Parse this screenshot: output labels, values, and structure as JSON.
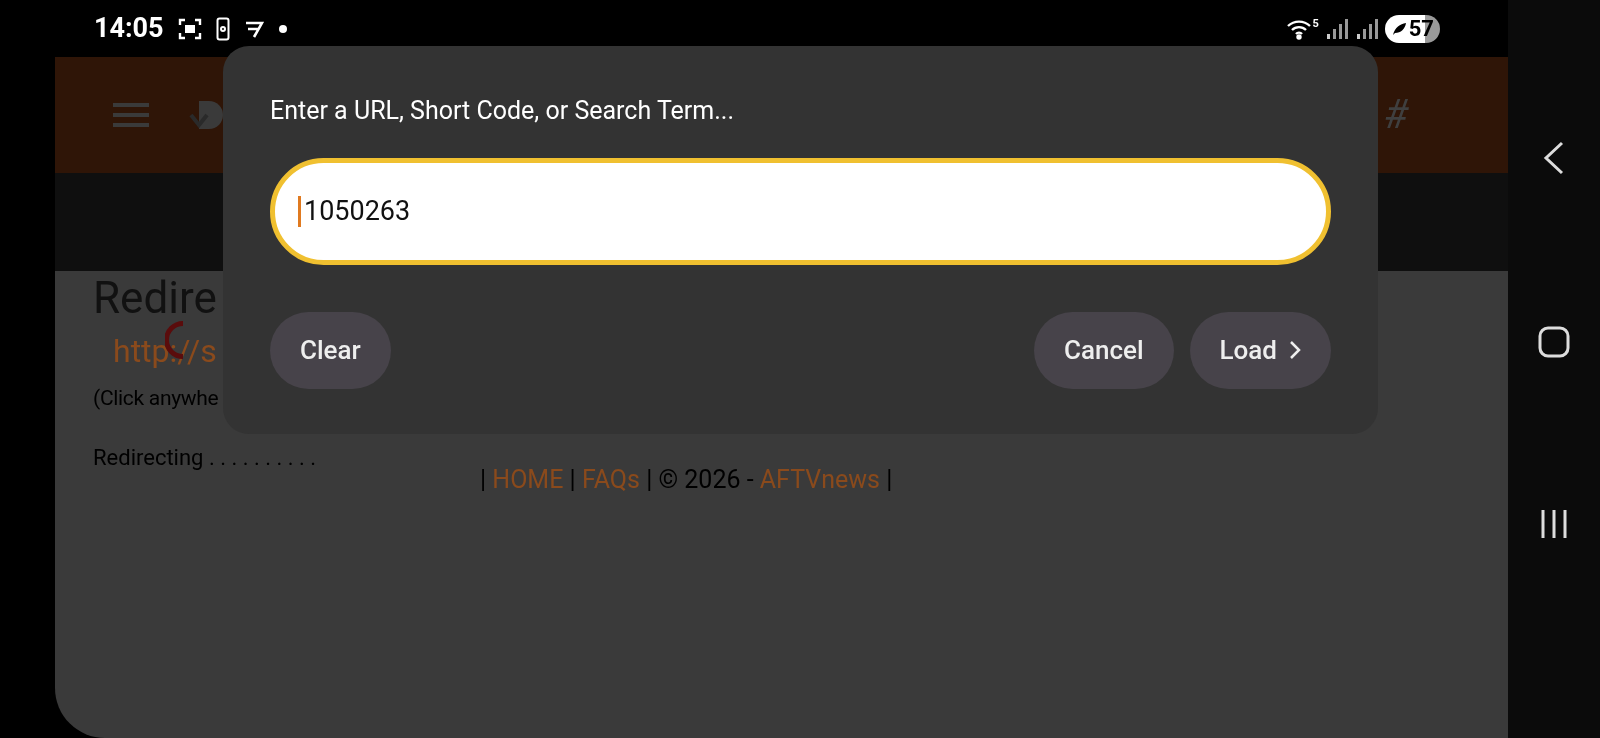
{
  "status_bar": {
    "time": "14:05",
    "wifi_badge": "5",
    "battery": "57"
  },
  "page": {
    "header_mark": "#",
    "title": "Redire",
    "link": "http://s",
    "note": "(Click anywhe",
    "redirecting": "Redirecting . . . . . . . . . .",
    "footer": [
      {
        "kind": "text",
        "text": "| "
      },
      {
        "kind": "link",
        "text": "HOME"
      },
      {
        "kind": "text",
        "text": " | "
      },
      {
        "kind": "link",
        "text": "FAQs"
      },
      {
        "kind": "text",
        "text": " | © 2026 - "
      },
      {
        "kind": "link",
        "text": "AFTVnews"
      },
      {
        "kind": "text",
        "text": " |"
      }
    ]
  },
  "dialog": {
    "title": "Enter a URL, Short Code, or Search Term...",
    "input": {
      "value": "1050263"
    },
    "left_buttons": [
      {
        "label": "Clear",
        "chevron": false
      }
    ],
    "right_buttons": [
      {
        "label": "Cancel",
        "chevron": false
      },
      {
        "label": "Load",
        "chevron": true
      }
    ]
  }
}
